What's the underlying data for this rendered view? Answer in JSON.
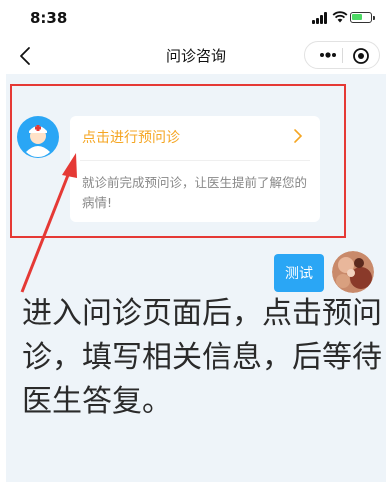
{
  "status_bar": {
    "time": "8:38"
  },
  "nav": {
    "title": "问诊咨询"
  },
  "card": {
    "link_text": "点击进行预问诊",
    "description": "就诊前完成预问诊，让医生提前了解您的病情!"
  },
  "user_message": {
    "text": "测试"
  },
  "annotation": {
    "text": "进入问诊页面后，点击预问诊，填写相关信息，后等待医生答复。"
  },
  "colors": {
    "accent_link": "#f5a623",
    "bubble": "#2aa6f5",
    "chat_background": "#eef4f9",
    "highlight": "#e53935"
  }
}
